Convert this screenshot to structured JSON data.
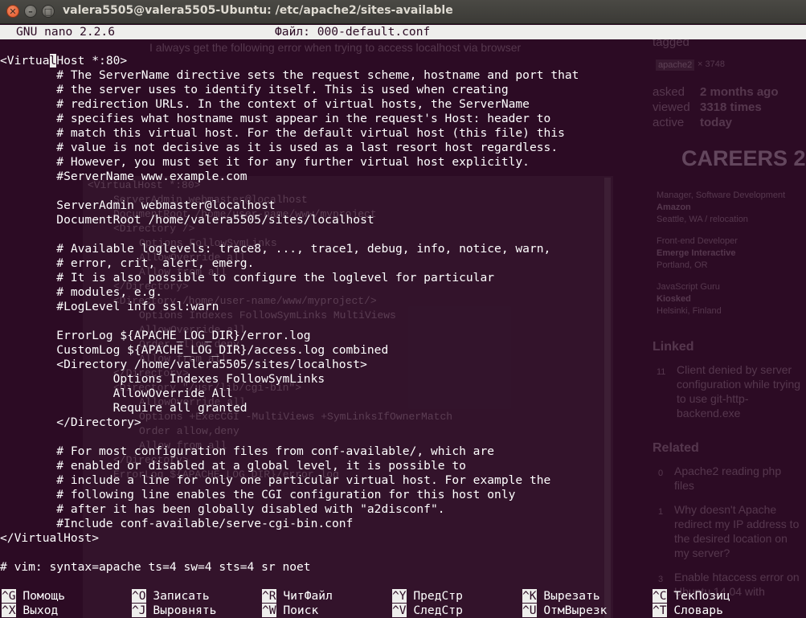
{
  "window": {
    "title": "valera5505@valera5505-Ubuntu: /etc/apache2/sites-available",
    "close_glyph": "✕",
    "min_glyph": "–",
    "max_glyph": "□"
  },
  "nano": {
    "app": "GNU nano 2.2.6",
    "file_label": "Файл: 000-default.conf"
  },
  "editor": {
    "line_0_pre": "<Virtua",
    "line_0_cursor": "l",
    "line_0_post": "Host *:80>",
    "lines": [
      "        # The ServerName directive sets the request scheme, hostname and port that",
      "        # the server uses to identify itself. This is used when creating",
      "        # redirection URLs. In the context of virtual hosts, the ServerName",
      "        # specifies what hostname must appear in the request's Host: header to",
      "        # match this virtual host. For the default virtual host (this file) this",
      "        # value is not decisive as it is used as a last resort host regardless.",
      "        # However, you must set it for any further virtual host explicitly.",
      "        #ServerName www.example.com",
      "",
      "        ServerAdmin webmaster@localhost",
      "        DocumentRoot /home/valera5505/sites/localhost",
      "",
      "        # Available loglevels: trace8, ..., trace1, debug, info, notice, warn,",
      "        # error, crit, alert, emerg.",
      "        # It is also possible to configure the loglevel for particular",
      "        # modules, e.g.",
      "        #LogLevel info ssl:warn",
      "",
      "        ErrorLog ${APACHE_LOG_DIR}/error.log",
      "        CustomLog ${APACHE_LOG_DIR}/access.log combined",
      "        <Directory /home/valera5505/sites/localhost>",
      "                Options Indexes FollowSymLinks",
      "                AllowOverride All",
      "                Require all granted",
      "        </Directory>",
      "",
      "        # For most configuration files from conf-available/, which are",
      "        # enabled or disabled at a global level, it is possible to",
      "        # include a line for only one particular virtual host. For example the",
      "        # following line enables the CGI configuration for this host only",
      "        # after it has been globally disabled with \"a2disconf\".",
      "        #Include conf-available/serve-cgi-bin.conf",
      "</VirtualHost>",
      "",
      "# vim: syntax=apache ts=4 sw=4 sts=4 sr noet"
    ]
  },
  "shortcuts": [
    {
      "key": "^G",
      "label": "Помощь"
    },
    {
      "key": "^O",
      "label": "Записать"
    },
    {
      "key": "^R",
      "label": "ЧитФайл"
    },
    {
      "key": "^Y",
      "label": "ПредСтр"
    },
    {
      "key": "^K",
      "label": "Вырезать"
    },
    {
      "key": "^C",
      "label": "ТекПозиц"
    },
    {
      "key": "^X",
      "label": "Выход"
    },
    {
      "key": "^J",
      "label": "Выровнять"
    },
    {
      "key": "^W",
      "label": "Поиск"
    },
    {
      "key": "^V",
      "label": "СледСтр"
    },
    {
      "key": "^U",
      "label": "ОтмВырезк"
    },
    {
      "key": "^T",
      "label": "Словарь"
    }
  ],
  "background_page": {
    "question_text": "I always get the following error when trying to access localhost via browser",
    "tagged": "tagged",
    "tag": "apache2",
    "tag_count": "× 3748",
    "asked_label": "asked",
    "asked_value": "2 months ago",
    "viewed_label": "viewed",
    "viewed_value": "3318 times",
    "active_label": "active",
    "active_value": "today",
    "careers": "CAREERS 2.",
    "jobs": [
      {
        "title": "Manager, Software Development",
        "company": "Amazon",
        "location": "Seattle, WA / relocation"
      },
      {
        "title": "Front-end Developer",
        "company": "Emerge Interactive",
        "location": "Portland, OR"
      },
      {
        "title": "JavaScript Guru",
        "company": "Kiosked",
        "location": "Helsinki, Finland"
      }
    ],
    "linked_heading": "Linked",
    "linked": [
      {
        "count": "11",
        "title_lines": [
          "Client denied by server",
          "configuration while trying",
          "to use git-http-",
          "backend.exe"
        ]
      }
    ],
    "related_heading": "Related",
    "related": [
      {
        "count": "0",
        "title_lines": [
          "Apache2 reading php",
          "files"
        ]
      },
      {
        "count": "1",
        "title_lines": [
          "Why doesn't Apache",
          "redirect my IP address to",
          "the desired location on",
          "my server?"
        ]
      },
      {
        "count": "3",
        "title_lines": [
          "Enable htaccess error on",
          "Ubuntu 14.04 with"
        ]
      }
    ],
    "code_lines": [
      "<VirtualHost *:80>",
      "ServerAdmin webmaster@localhost",
      "DocumentRoot /home/user-name/www/myproject",
      "<Directory />",
      "Options FollowSymLinks",
      "AllowOverride all",
      "Allow from all",
      "</Directory>",
      "<Directory /home/user-name/www/myproject/>",
      "Options Indexes FollowSymLinks MultiViews",
      "AllowOverride all",
      "Order allow,deny",
      "Allow from all",
      "</Directory>",
      "<Directory \"/usr/lib/cgi-bin\">",
      "AllowOverride all",
      "Options +ExecCGI -MultiViews +SymLinksIfOwnerMatch",
      "Order allow,deny",
      "Allow from all",
      "</Directory>",
      "ErrorLog ${APACHE_LOG_DIR}/error.log"
    ]
  }
}
